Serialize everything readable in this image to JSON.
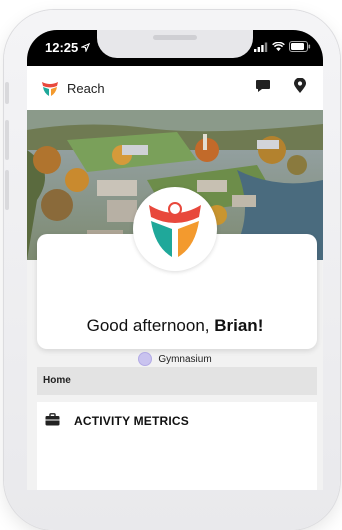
{
  "status_bar": {
    "time": "12:25"
  },
  "app": {
    "title": "Reach"
  },
  "greeting": {
    "prefix": "Good afternoon,",
    "name": "Brian!"
  },
  "location": {
    "name": "Gymnasium"
  },
  "section": {
    "title": "Home"
  },
  "metrics": {
    "title": "ACTIVITY METRICS"
  },
  "colors": {
    "logo_red": "#e8483c",
    "logo_teal": "#1fa89a",
    "logo_orange": "#f39a2e",
    "location_dot": "#c9c3ef"
  },
  "icons": [
    "location-arrow-icon",
    "signal-icon",
    "wifi-icon",
    "battery-icon",
    "reach-logo",
    "chat-icon",
    "map-pin-icon",
    "briefcase-icon"
  ]
}
